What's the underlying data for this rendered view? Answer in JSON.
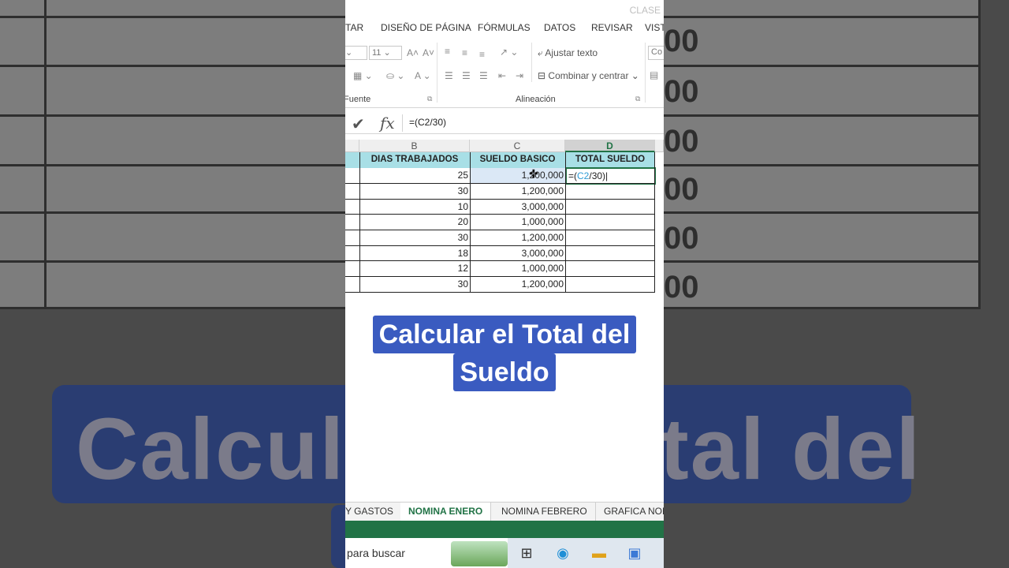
{
  "window": {
    "title_fragment": "CLASE"
  },
  "ribbon_tabs": [
    "TAR",
    "DISEÑO DE PÁGINA",
    "FÓRMULAS",
    "DATOS",
    "REVISAR",
    "VISTA"
  ],
  "ribbon": {
    "font_size": "11",
    "wrap_text": "Ajustar texto",
    "merge_center": "Combinar y centrar",
    "group_font": "Fuente",
    "group_alignment": "Alineación",
    "number_format_fragment": "Co"
  },
  "formula_bar": {
    "formula": "=(C2/30)",
    "fx_label": "fx"
  },
  "columns": [
    "B",
    "C",
    "D"
  ],
  "headers": [
    "DIAS TRABAJADOS",
    "SUELDO BASICO",
    "TOTAL SUELDO"
  ],
  "rows": [
    {
      "dias": "25",
      "sueldo": "1,200,000",
      "total": ""
    },
    {
      "dias": "30",
      "sueldo": "1,200,000",
      "total": ""
    },
    {
      "dias": "10",
      "sueldo": "3,000,000",
      "total": ""
    },
    {
      "dias": "20",
      "sueldo": "1,000,000",
      "total": ""
    },
    {
      "dias": "30",
      "sueldo": "1,200,000",
      "total": ""
    },
    {
      "dias": "18",
      "sueldo": "3,000,000",
      "total": ""
    },
    {
      "dias": "12",
      "sueldo": "1,000,000",
      "total": ""
    },
    {
      "dias": "30",
      "sueldo": "1,200,000",
      "total": ""
    }
  ],
  "editing_cell": {
    "prefix": "=(",
    "ref": "C2",
    "suffix": "/30)"
  },
  "caption": {
    "line1": "Calcular el Total del",
    "line2": "Sueldo"
  },
  "background_text": "Calcular el Total del",
  "background_numbers": [
    "00",
    "00",
    "00",
    "00",
    "00",
    "00"
  ],
  "sheet_tabs": [
    "Y GASTOS",
    "NOMINA ENERO",
    "NOMINA FEBRERO",
    "GRAFICA NOM"
  ],
  "taskbar": {
    "search_placeholder": "para buscar"
  },
  "colors": {
    "excel_green": "#217346",
    "header_fill": "#a8dfe6",
    "caption_bg": "#3a5bc0"
  }
}
